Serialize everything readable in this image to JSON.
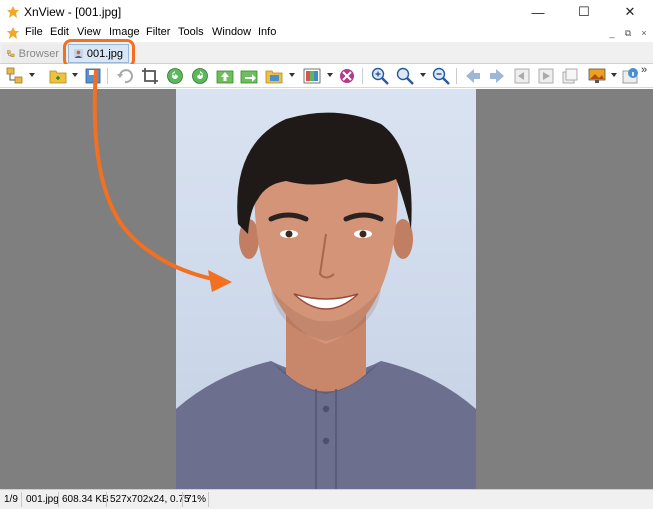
{
  "window": {
    "title": "XnView - [001.jpg]",
    "minimize_label": "—",
    "maximize_label": "☐",
    "close_label": "✕"
  },
  "menu": {
    "items": [
      "File",
      "Edit",
      "View",
      "Image",
      "Filter",
      "Tools",
      "Window",
      "Info"
    ],
    "mdi_minimize": "_",
    "mdi_restore": "⧉",
    "mdi_close": "×"
  },
  "tabs": [
    {
      "label": "Browser",
      "active": false
    },
    {
      "label": "001.jpg",
      "active": true
    }
  ],
  "toolbar": {
    "icons": [
      "browser-tree-icon",
      "open-folder-icon",
      "save-icon",
      "undo-icon",
      "crop-icon",
      "rotate-left-icon",
      "rotate-right-icon",
      "upload-icon",
      "export-icon",
      "image-folder-icon",
      "color-adjust-icon",
      "red-eye-icon",
      "zoom-in-icon",
      "zoom-fit-icon",
      "zoom-out-icon",
      "previous-icon",
      "next-icon",
      "first-page-icon",
      "slideshow-icon",
      "fullscreen-icon",
      "wallpaper-icon",
      "image-info-icon"
    ],
    "overflow_label": "»"
  },
  "statusbar": {
    "index": "1/9",
    "filename": "001.jpg",
    "filesize": "608.34 KB",
    "dimensions": "527x702x24, 0.75",
    "zoom": "71%"
  },
  "colors": {
    "accent_orange": "#f37021",
    "viewer_bg": "#7f7f7f",
    "active_tab": "#d8e6f5"
  }
}
